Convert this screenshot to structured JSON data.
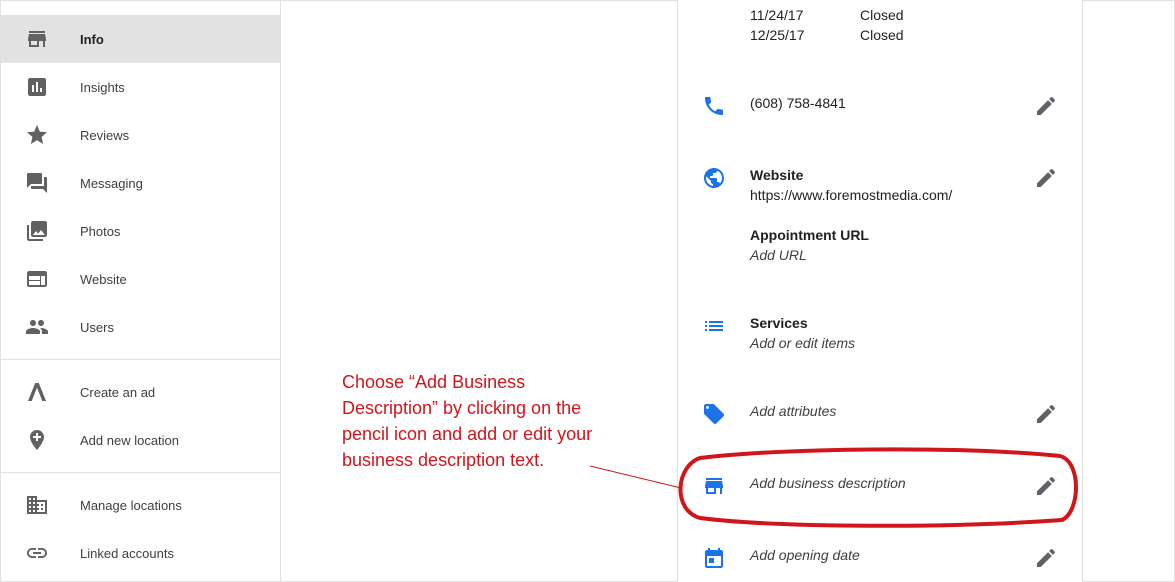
{
  "sidebar": {
    "items": [
      {
        "label": "Info",
        "icon": "store-icon"
      },
      {
        "label": "Insights",
        "icon": "bar-chart-icon"
      },
      {
        "label": "Reviews",
        "icon": "star-icon"
      },
      {
        "label": "Messaging",
        "icon": "chat-icon"
      },
      {
        "label": "Photos",
        "icon": "photos-icon"
      },
      {
        "label": "Website",
        "icon": "web-icon"
      },
      {
        "label": "Users",
        "icon": "people-icon"
      },
      {
        "label": "Create an ad",
        "icon": "ads-icon"
      },
      {
        "label": "Add new location",
        "icon": "add-location-icon"
      },
      {
        "label": "Manage locations",
        "icon": "building-icon"
      },
      {
        "label": "Linked accounts",
        "icon": "link-icon"
      }
    ]
  },
  "info": {
    "hours": [
      {
        "date": "11/24/17",
        "status": "Closed"
      },
      {
        "date": "12/25/17",
        "status": "Closed"
      }
    ],
    "phone": "(608) 758-4841",
    "website_title": "Website",
    "website_url": "https://www.foremostmedia.com/",
    "appointment_title": "Appointment URL",
    "appointment_value": "Add URL",
    "services_title": "Services",
    "services_value": "Add or edit items",
    "attributes_value": "Add attributes",
    "description_value": "Add business description",
    "opening_date_value": "Add opening date"
  },
  "annotation": {
    "lines": [
      "Choose “Add Business",
      "Description” by clicking on the",
      "pencil icon and add or edit your",
      "business description text."
    ],
    "color": "#d0161b"
  },
  "colors": {
    "accent": "#1a73e8",
    "active_bg": "#e2e2e2",
    "annotation": "#d0161b"
  }
}
